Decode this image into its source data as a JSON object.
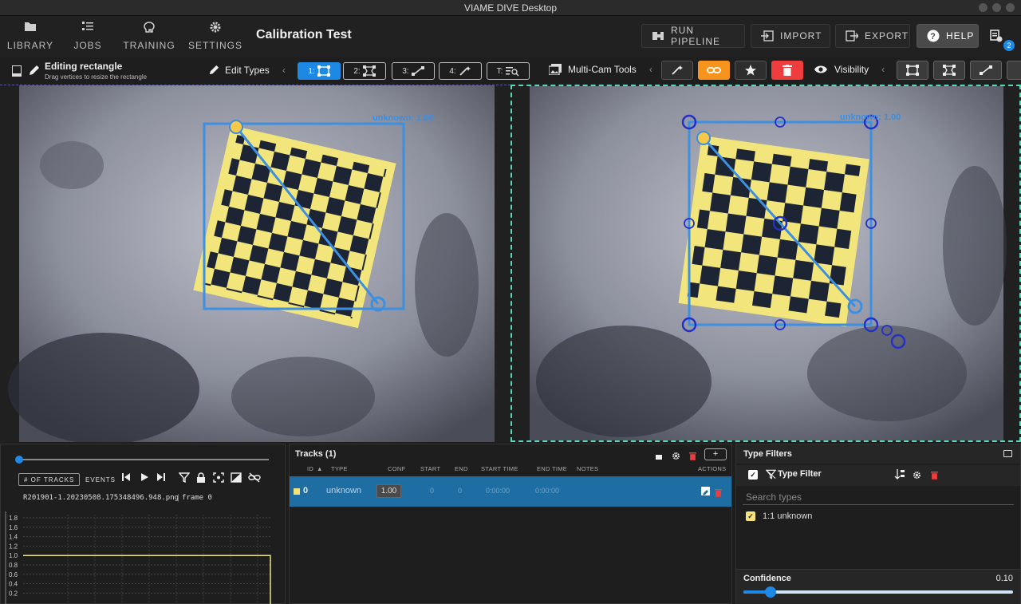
{
  "window": {
    "title": "VIAME DIVE Desktop"
  },
  "nav": [
    {
      "label": "LIBRARY",
      "icon": "folder-icon"
    },
    {
      "label": "JOBS",
      "icon": "tasks-icon"
    },
    {
      "label": "TRAINING",
      "icon": "brain-icon"
    },
    {
      "label": "SETTINGS",
      "icon": "gear-icon"
    }
  ],
  "project": {
    "title": "Calibration Test"
  },
  "topbar": {
    "run_pipeline": "RUN PIPELINE",
    "import": "IMPORT",
    "export": "EXPORT",
    "help": "HELP",
    "jobs_badge": "2"
  },
  "toolbar": {
    "editing_title": "Editing rectangle",
    "editing_subtitle": "Drag vertices to resize the rectangle",
    "edit_types": "Edit Types",
    "type_keys": [
      "1:",
      "2:",
      "3:",
      "4:",
      "T:"
    ],
    "multicam": "Multi-Cam Tools",
    "visibility": "Visibility"
  },
  "viewer": {
    "left_label": "unknown: 1.00",
    "right_label": "unknown: 1.00"
  },
  "timeline": {
    "tracks_chip": "# OF TRACKS",
    "events_chip": "EVENTS",
    "filename": "R201901-1.20230508.175348496.948.png",
    "frame": "frame 0",
    "y_ticks": [
      "1.8",
      "1.6",
      "1.4",
      "1.2",
      "1.0",
      "0.8",
      "0.6",
      "0.4",
      "0.2"
    ],
    "track_count_value": 1.0
  },
  "tracks": {
    "title": "Tracks (1)",
    "columns": [
      "ID",
      "TYPE",
      "CONF",
      "START",
      "END",
      "START TIME",
      "END TIME",
      "NOTES",
      "ACTIONS"
    ],
    "add_label": "+",
    "rows": [
      {
        "id": "0",
        "type": "unknown",
        "conf": "1.00",
        "start": "0",
        "end": "0",
        "start_time": "0:00:00",
        "end_time": "0:00:00",
        "notes": ""
      }
    ]
  },
  "type_filters": {
    "title": "Type Filters",
    "filter_label": "Type Filter",
    "search_placeholder": "Search types",
    "types": [
      {
        "label": "1:1 unknown",
        "checked": true,
        "color": "#f5e27a"
      }
    ],
    "confidence_label": "Confidence",
    "confidence_value": "0.10",
    "confidence": 0.1
  },
  "colors": {
    "accent": "#1e88e5",
    "orange": "#f7941d",
    "red": "#ef3d3d",
    "row": "#1f6ea3",
    "annotation": "#3d8fe0",
    "handle": "#f7c948"
  }
}
